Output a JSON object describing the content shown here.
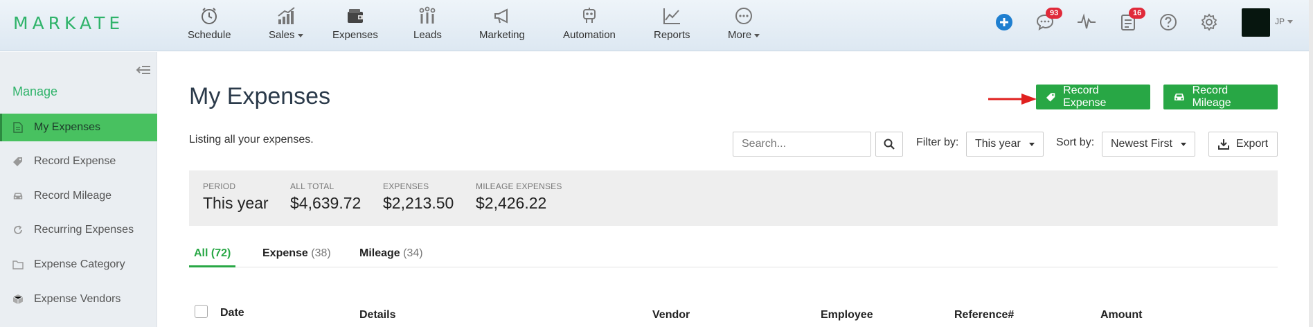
{
  "app": {
    "logo": "MARKATE"
  },
  "nav": {
    "items": [
      {
        "label": "Schedule",
        "icon": "clock-icon",
        "dropdown": false
      },
      {
        "label": "Sales",
        "icon": "sales-chart-icon",
        "dropdown": true
      },
      {
        "label": "Expenses",
        "icon": "wallet-icon",
        "dropdown": false
      },
      {
        "label": "Leads",
        "icon": "leads-icon",
        "dropdown": false
      },
      {
        "label": "Marketing",
        "icon": "megaphone-icon",
        "dropdown": false
      },
      {
        "label": "Automation",
        "icon": "robot-icon",
        "dropdown": false
      },
      {
        "label": "Reports",
        "icon": "line-chart-icon",
        "dropdown": false
      },
      {
        "label": "More",
        "icon": "more-dots-icon",
        "dropdown": true
      }
    ],
    "messages_badge": "93",
    "tasks_badge": "16",
    "user_initials": "JP"
  },
  "sidebar": {
    "title": "Manage",
    "items": [
      {
        "label": "My Expenses",
        "icon": "document-icon",
        "active": true
      },
      {
        "label": "Record Expense",
        "icon": "tag-icon",
        "active": false
      },
      {
        "label": "Record Mileage",
        "icon": "car-icon",
        "active": false
      },
      {
        "label": "Recurring Expenses",
        "icon": "refresh-icon",
        "active": false
      },
      {
        "label": "Expense Category",
        "icon": "folder-icon",
        "active": false
      },
      {
        "label": "Expense Vendors",
        "icon": "box-icon",
        "active": false
      }
    ]
  },
  "main": {
    "title": "My Expenses",
    "subtitle": "Listing all your expenses.",
    "record_expense_label": "Record Expense",
    "record_mileage_label": "Record Mileage",
    "search_placeholder": "Search...",
    "filter_label": "Filter by:",
    "filter_value": "This year",
    "sort_label": "Sort by:",
    "sort_value": "Newest First",
    "export_label": "Export",
    "summary": {
      "period_label": "PERIOD",
      "period_value": "This year",
      "total_label": "ALL TOTAL",
      "total_value": "$4,639.72",
      "expenses_label": "EXPENSES",
      "expenses_value": "$2,213.50",
      "mileage_label": "MILEAGE EXPENSES",
      "mileage_value": "$2,426.22"
    },
    "tabs": [
      {
        "label": "All",
        "count": "(72)",
        "active": true
      },
      {
        "label": "Expense",
        "count": "(38)",
        "active": false
      },
      {
        "label": "Mileage",
        "count": "(34)",
        "active": false
      }
    ],
    "table_headers": {
      "date": "Date",
      "details": "Details",
      "vendor": "Vendor",
      "employee": "Employee",
      "reference": "Reference#",
      "amount": "Amount"
    }
  },
  "colors": {
    "brand_green": "#2fb36a",
    "button_green": "#28a745",
    "badge_red": "#e02a3a",
    "arrow_red": "#e0201f"
  }
}
